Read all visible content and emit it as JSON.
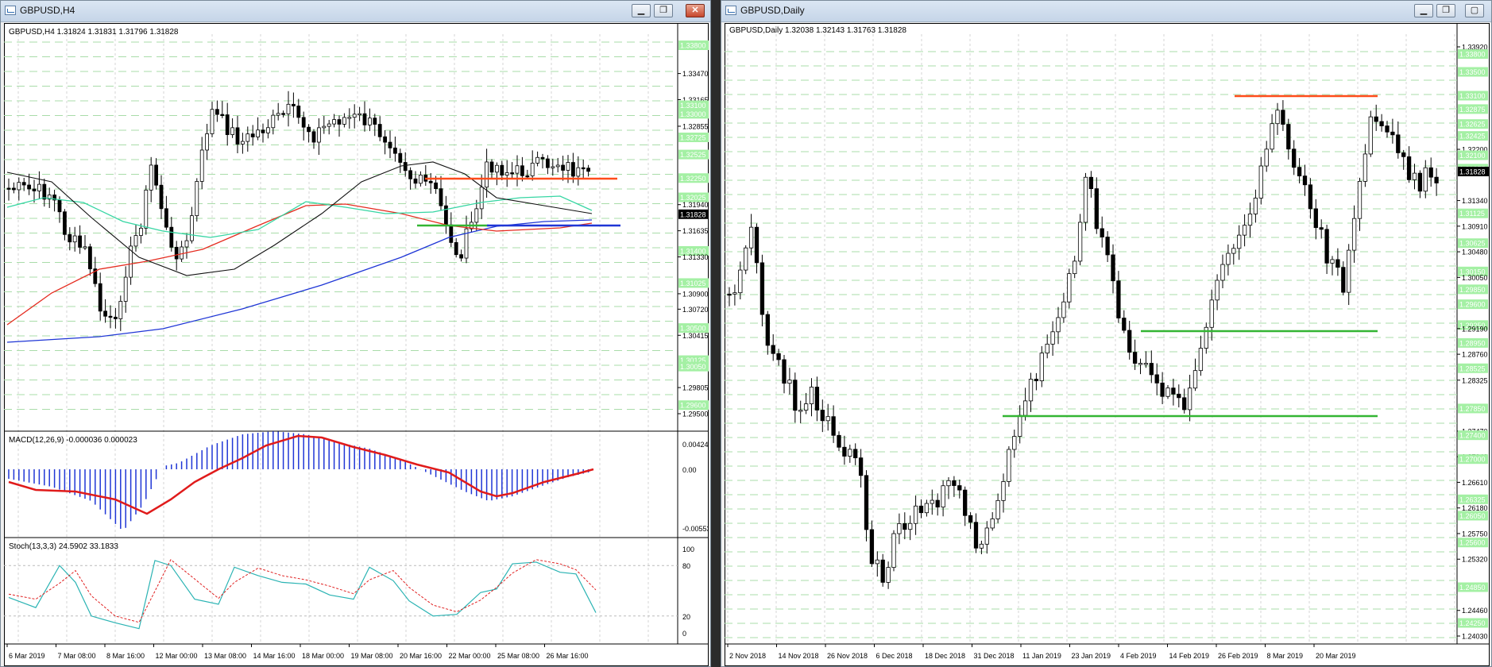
{
  "colors": {
    "grid": "#a9dca9",
    "resistance": "#ff4c1a",
    "support": "#33b533",
    "ma_blue": "#1f36d6",
    "ma_red": "#e52b1f",
    "ma_black": "#111111",
    "ma_teal": "#36d6a3",
    "macd_hist": "#1f36d6",
    "macd_signal": "#e01b1b",
    "stoch_main": "#2ab3b3",
    "stoch_signal": "#e02020",
    "price_tag_bg": "#a4f0a4",
    "current_tag_bg": "#000000"
  },
  "window_h4": {
    "title": "GBPUSD,H4",
    "header": "GBPUSD,H4  1.31824 1.31831 1.31796 1.31828",
    "price_labels": [
      "1.33800",
      "1.33470",
      "1.33165",
      "1.33100",
      "1.33000",
      "1.32855",
      "1.32725",
      "1.32525",
      "1.32250",
      "1.32025",
      "1.31940",
      "1.31828",
      "1.31635",
      "1.31400",
      "1.31330",
      "1.31025",
      "1.30900",
      "1.30720",
      "1.30500",
      "1.30415",
      "1.30125",
      "1.30050",
      "1.29805",
      "1.29600",
      "1.29500"
    ],
    "current_price": "1.31828",
    "time_labels": [
      "6 Mar 2019",
      "7 Mar 08:00",
      "8 Mar 16:00",
      "12 Mar 00:00",
      "13 Mar 08:00",
      "14 Mar 16:00",
      "18 Mar 00:00",
      "19 Mar 08:00",
      "20 Mar 16:00",
      "22 Mar 00:00",
      "25 Mar 08:00",
      "26 Mar 16:00"
    ],
    "macd": {
      "header": "MACD(12,26,9) -0.000036 0.000023",
      "labels": [
        "0.004243",
        "0.00",
        "-0.005533"
      ]
    },
    "stoch": {
      "header": "Stoch(13,3,3) 24.5902 33.1833",
      "labels": [
        "100",
        "80",
        "20",
        "0"
      ]
    }
  },
  "window_daily": {
    "title": "GBPUSD,Daily",
    "header": "GBPUSD,Daily  1.32038 1.32143 1.31763 1.31828",
    "price_labels": [
      "1.33920",
      "1.33800",
      "1.33500",
      "1.33100",
      "1.32875",
      "1.32625",
      "1.32425",
      "1.32200",
      "1.32100",
      "1.31875",
      "1.31828",
      "1.31340",
      "1.31125",
      "1.30910",
      "1.30625",
      "1.30480",
      "1.30150",
      "1.30050",
      "1.29850",
      "1.29600",
      "1.29250",
      "1.29190",
      "1.28950",
      "1.28760",
      "1.28525",
      "1.28325",
      "1.27850",
      "1.27470",
      "1.27400",
      "1.27040",
      "1.27000",
      "1.26610",
      "1.26325",
      "1.26180",
      "1.26050",
      "1.25750",
      "1.25600",
      "1.25320",
      "1.24850",
      "1.24460",
      "1.24250",
      "1.24030"
    ],
    "time_labels": [
      "2 Nov 2018",
      "14 Nov 2018",
      "26 Nov 2018",
      "6 Dec 2018",
      "18 Dec 2018",
      "31 Dec 2018",
      "11 Jan 2019",
      "23 Jan 2019",
      "4 Feb 2019",
      "14 Feb 2019",
      "26 Feb 2019",
      "8 Mar 2019",
      "20 Mar 2019"
    ]
  }
}
